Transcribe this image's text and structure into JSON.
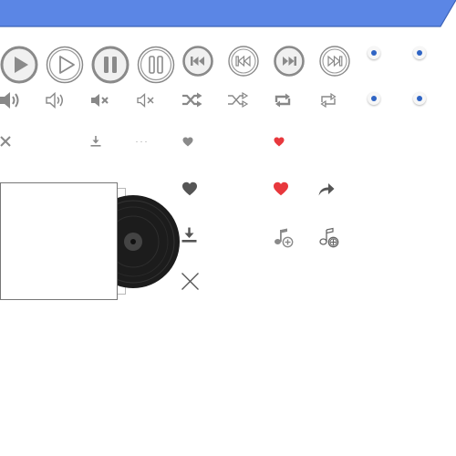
{
  "colors": {
    "accent_bar": "#5b86e5",
    "heart_active": "#e8383d",
    "dot_blue": "#2f64c4",
    "icon_gray": "#888888",
    "icon_dark": "#555555"
  },
  "rows": {
    "playback": [
      "play-large-icon",
      "play-outline-icon",
      "pause-large-icon",
      "pause-outline-icon",
      "previous-track-icon",
      "previous-track-outline-icon",
      "next-track-icon",
      "next-track-outline-icon",
      "radio-dot-icon",
      "radio-dot-icon"
    ],
    "volume_mode": [
      "volume-icon",
      "volume-outline-icon",
      "mute-icon",
      "mute-outline-icon",
      "shuffle-icon",
      "shuffle-outline-icon",
      "repeat-icon",
      "repeat-outline-icon",
      "radio-dot-icon",
      "radio-dot-icon"
    ],
    "small_actions": [
      "close-icon",
      "download-icon",
      "heart-gray-icon",
      "heart-red-icon"
    ],
    "large_actions": [
      "heart-dark-icon",
      "heart-red-large-icon",
      "share-icon",
      "download-large-icon",
      "add-to-playlist-icon",
      "add-to-playlist-outline-icon",
      "close-large-icon"
    ]
  },
  "album": {
    "artwork": "album-cover",
    "record": "vinyl-record-icon"
  }
}
